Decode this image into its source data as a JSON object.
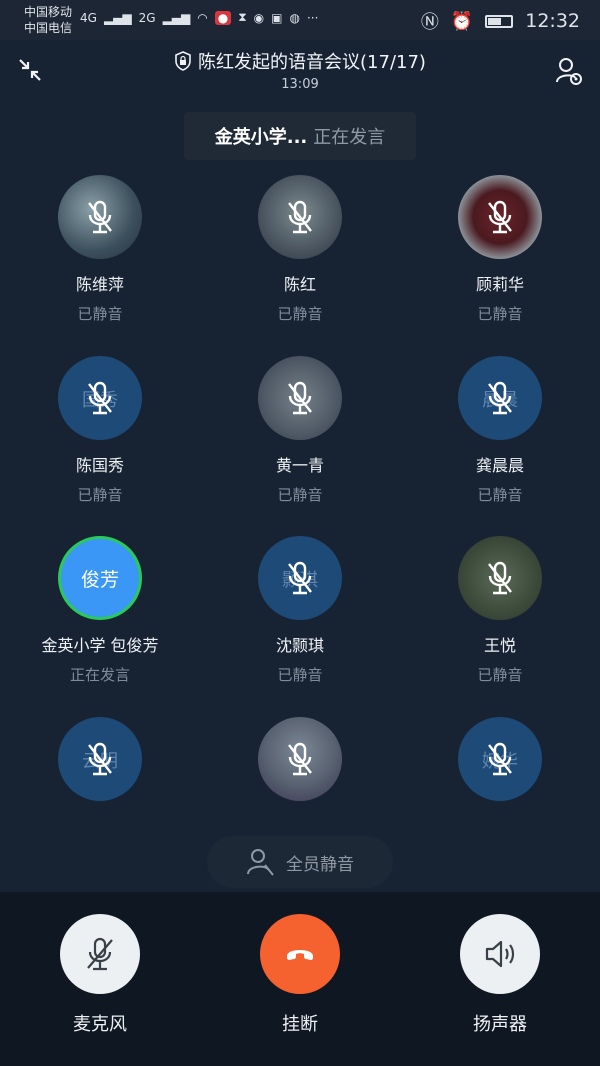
{
  "status_bar": {
    "carrier1": "中国移动",
    "carrier2": "中国电信",
    "net1": "4G",
    "net2": "2G",
    "time": "12:32"
  },
  "header": {
    "title": "陈红发起的语音会议(17/17)",
    "elapsed": "13:09"
  },
  "speaking_bar": {
    "name": "金英小学...",
    "status": "正在发言"
  },
  "participants": [
    {
      "name": "陈维萍",
      "status": "已静音",
      "initials": ""
    },
    {
      "name": "陈红",
      "status": "已静音",
      "initials": ""
    },
    {
      "name": "顾莉华",
      "status": "已静音",
      "initials": ""
    },
    {
      "name": "陈国秀",
      "status": "已静音",
      "initials": "国秀"
    },
    {
      "name": "黄一青",
      "status": "已静音",
      "initials": ""
    },
    {
      "name": "龚晨晨",
      "status": "已静音",
      "initials": "晨晨"
    },
    {
      "name": "金英小学  包俊芳",
      "status": "正在发言",
      "initials": "俊芳"
    },
    {
      "name": "沈颢琪",
      "status": "已静音",
      "initials": "颢琪"
    },
    {
      "name": "王悦",
      "status": "已静音",
      "initials": ""
    },
    {
      "name": "",
      "status": "",
      "initials": "云明"
    },
    {
      "name": "",
      "status": "",
      "initials": ""
    },
    {
      "name": "",
      "status": "",
      "initials": "婉华"
    }
  ],
  "mute_all_label": "全员静音",
  "controls": {
    "mic_label": "麦克风",
    "hangup_label": "挂断",
    "speaker_label": "扬声器"
  }
}
